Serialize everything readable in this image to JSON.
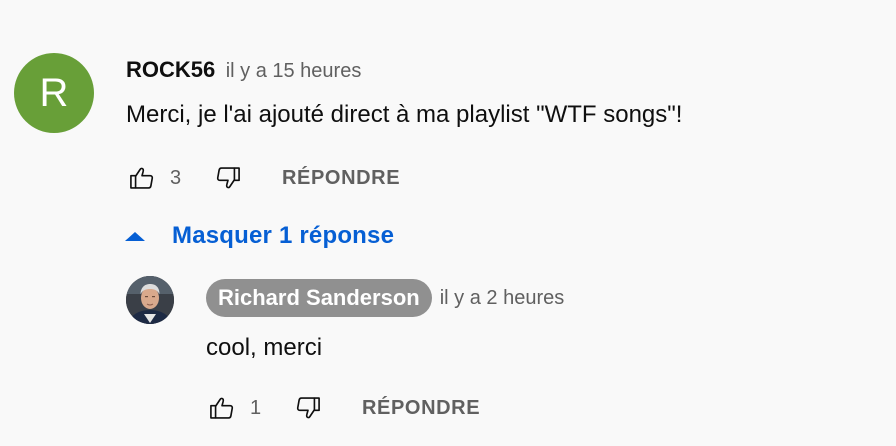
{
  "comment": {
    "avatar_letter": "R",
    "avatar_color": "#689f38",
    "author": "ROCK56",
    "time": "il y a 15 heures",
    "text": "Merci, je l'ai ajouté direct à ma playlist \"WTF songs\"!",
    "like_icon": "thumb-up-icon",
    "likes": "3",
    "dislike_icon": "thumb-down-icon",
    "reply_label": "RÉPONDRE"
  },
  "replies_toggle": {
    "icon": "caret-up-icon",
    "label": "Masquer 1 réponse",
    "color": "#065fd4"
  },
  "reply": {
    "avatar": "avatar-photo",
    "author": "Richard Sanderson",
    "author_badge_color": "#909090",
    "time": "il y a 2 heures",
    "text": "cool, merci",
    "likes": "1",
    "reply_label": "RÉPONDRE"
  }
}
